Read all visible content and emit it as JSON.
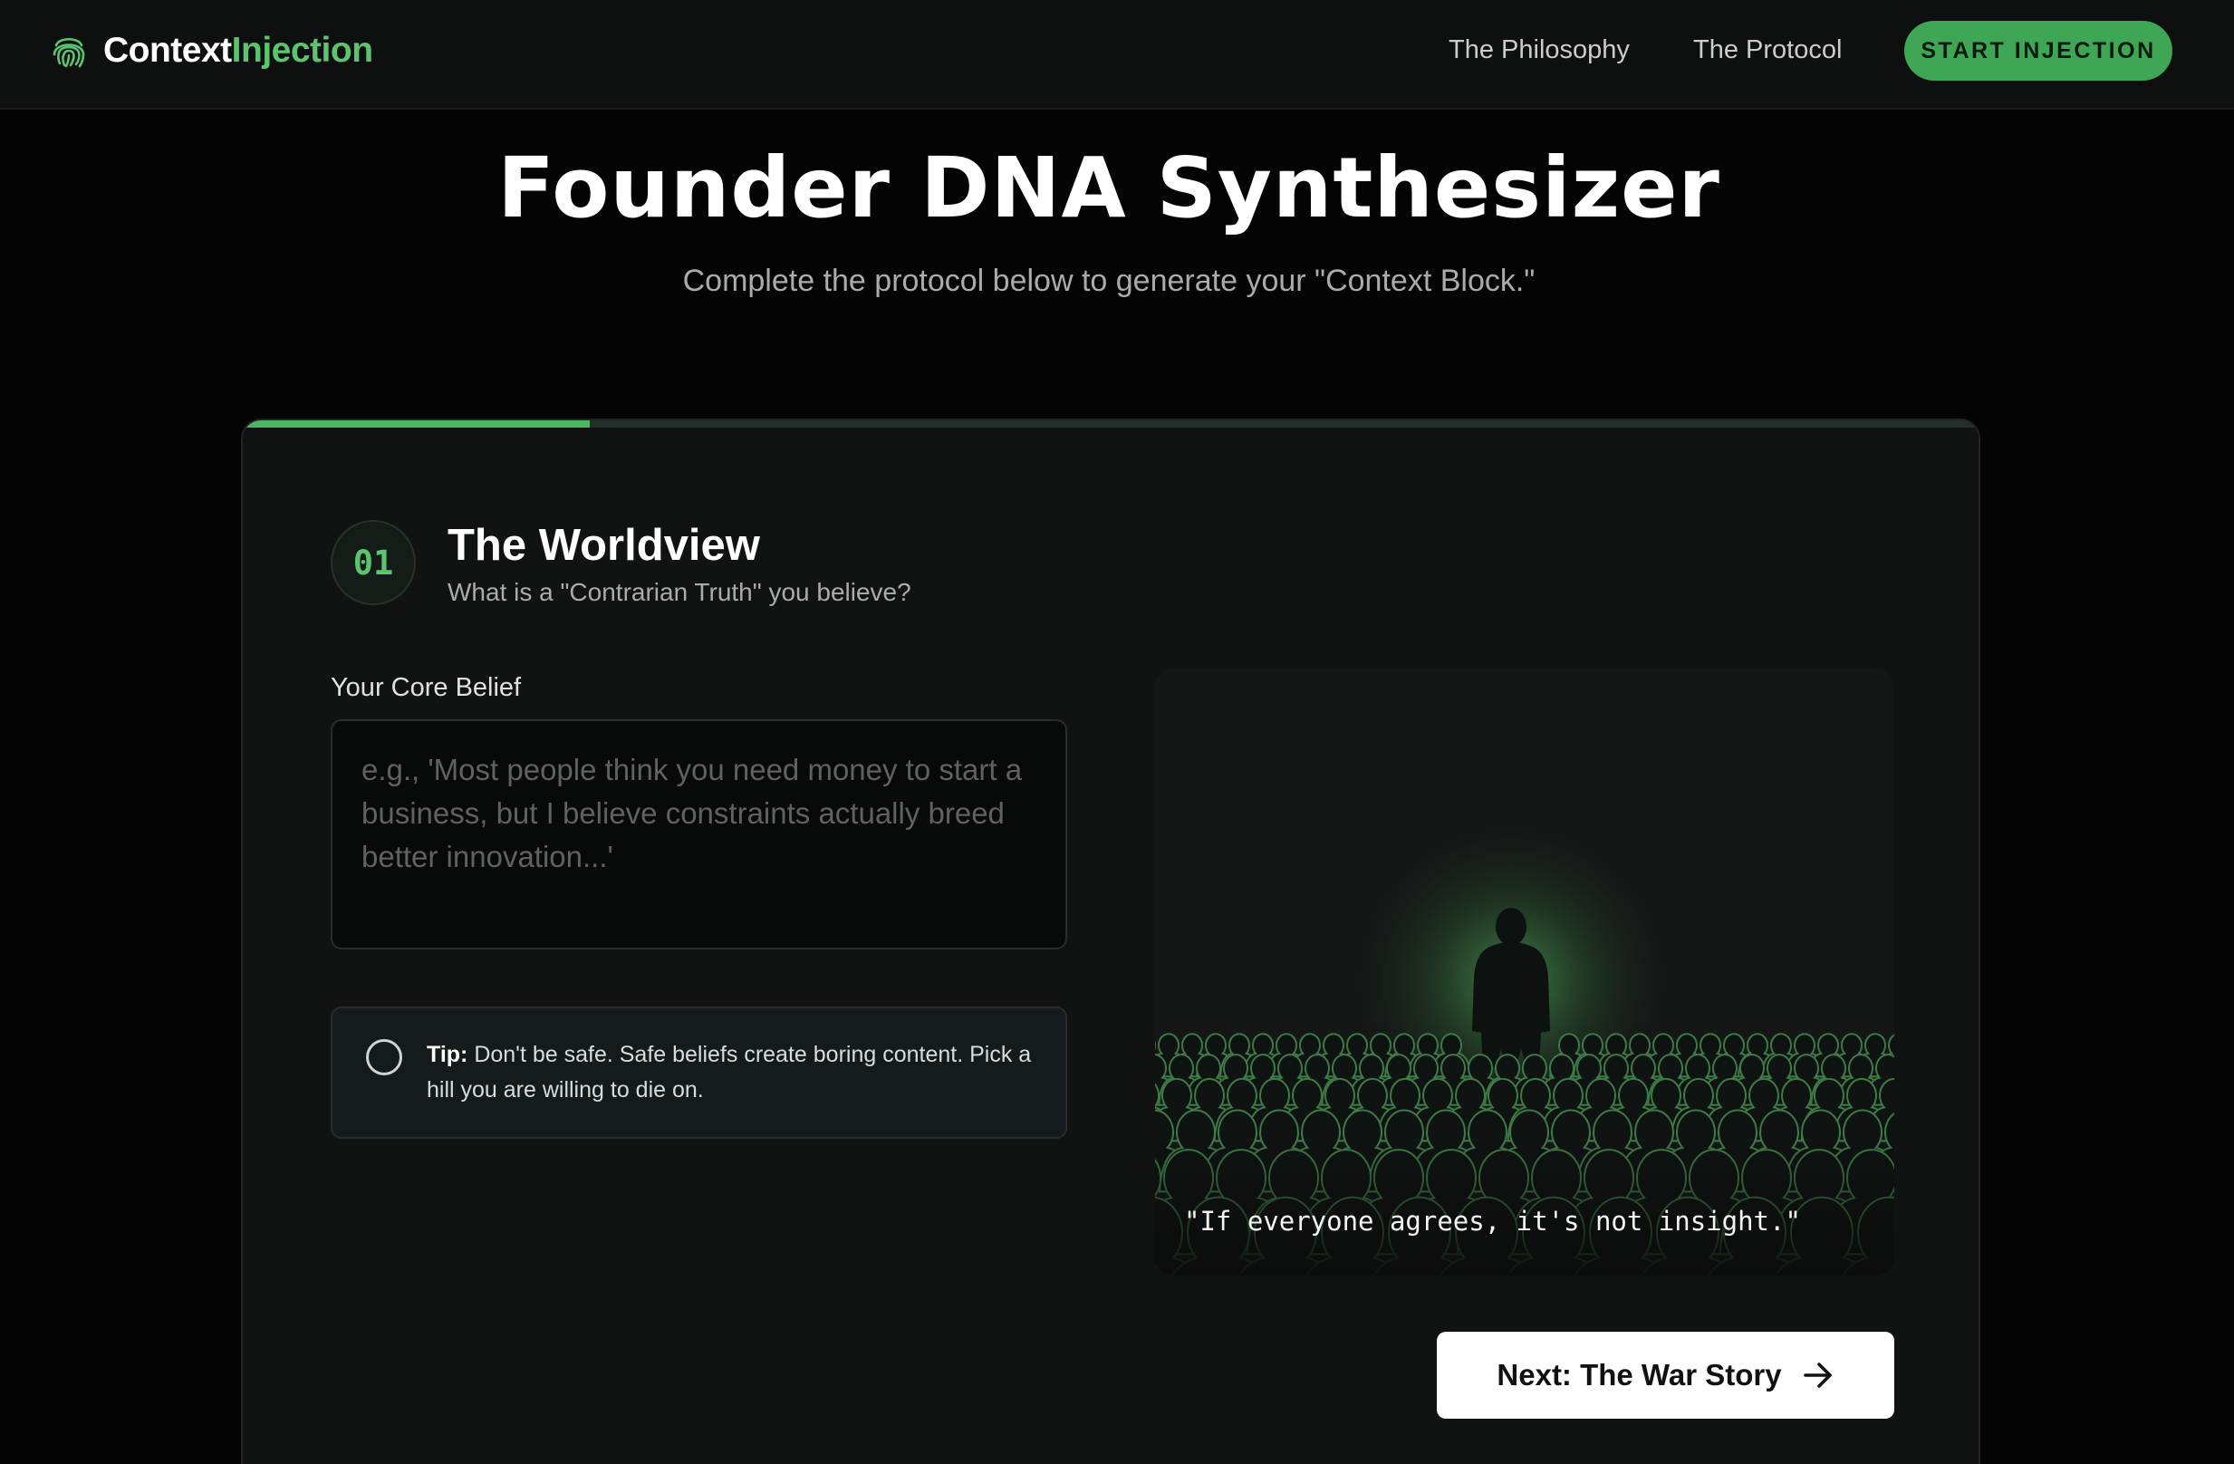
{
  "nav": {
    "brand_prefix": "Context",
    "brand_suffix": "Injection",
    "brand_icon": "fingerprint-icon",
    "links": [
      {
        "label": "The Philosophy"
      },
      {
        "label": "The Protocol"
      }
    ],
    "cta_label": "START INJECTION"
  },
  "hero": {
    "title": "Founder DNA Synthesizer",
    "subtitle": "Complete the protocol below to generate your \"Context Block.\""
  },
  "progress": {
    "fraction": 0.2
  },
  "step": {
    "number": "01",
    "title": "The Worldview",
    "subtitle": "What is a \"Contrarian Truth\" you believe?",
    "field_label": "Your Core Belief",
    "field_value": "",
    "field_placeholder": "e.g., 'Most people think you need money to start a business, but I believe constraints actually breed better innovation...'",
    "tip_label": "Tip:",
    "tip_text": " Don't be safe. Safe beliefs create boring content. Pick a hill you are willing to die on.",
    "tip_icon": "circle-icon",
    "quote": "\"If everyone agrees, it's not insight.\"",
    "next_label": "Next: The War Story",
    "next_icon": "arrow-right-icon"
  },
  "colors": {
    "accent": "#5cc46e",
    "cta_bg": "#3fa655",
    "background": "#040404",
    "card": "#111212"
  }
}
